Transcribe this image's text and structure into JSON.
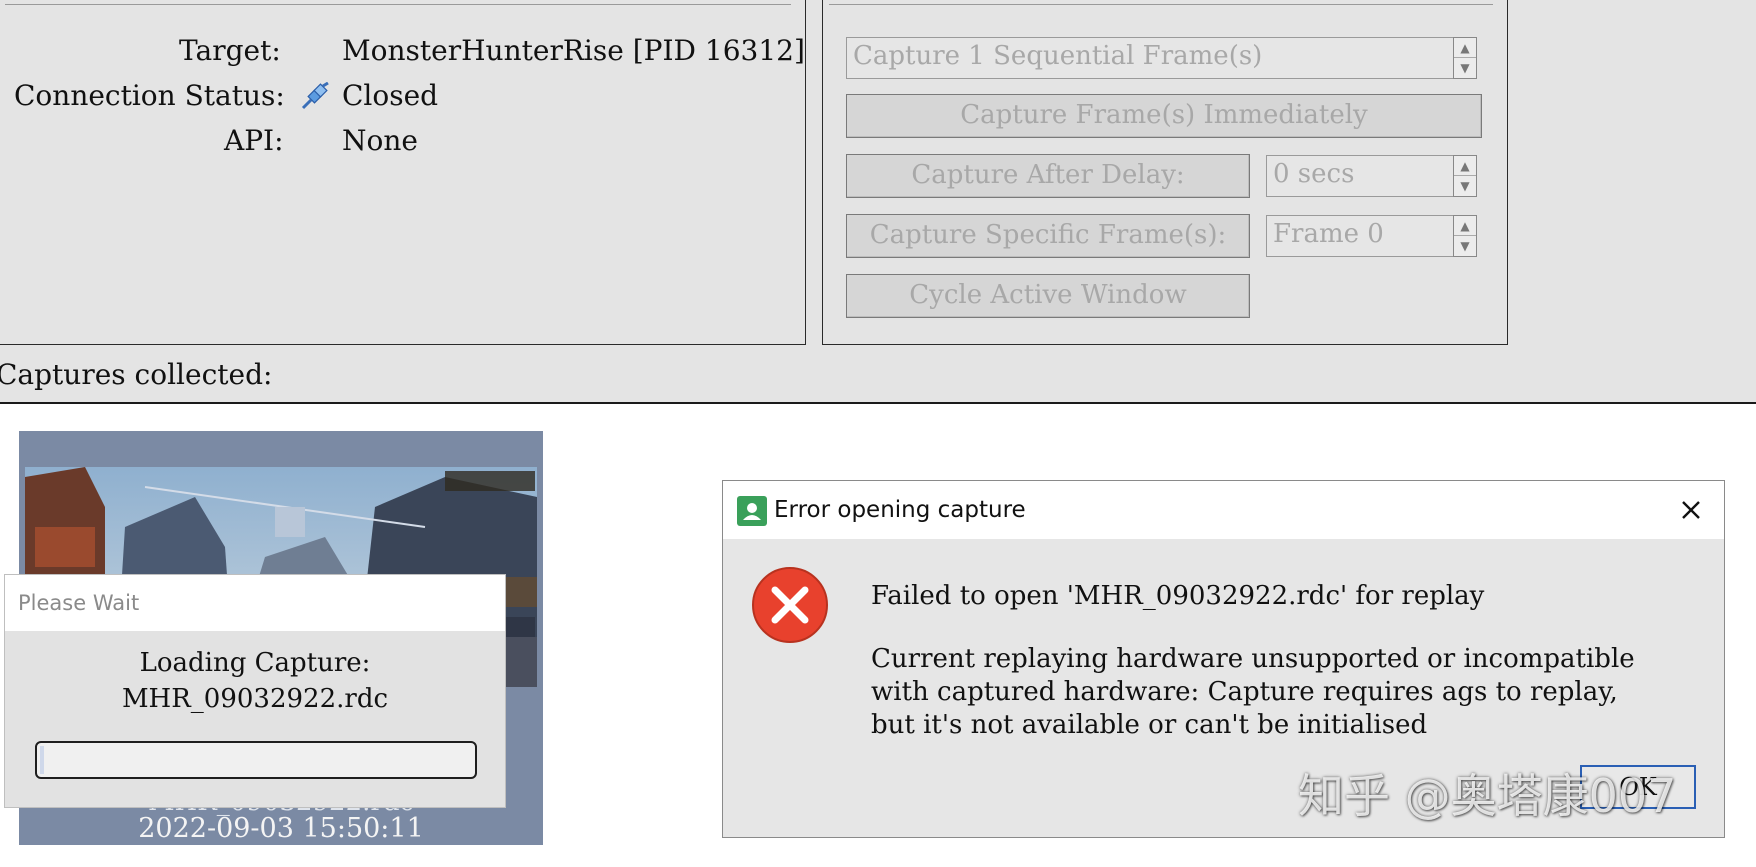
{
  "connection": {
    "target_label": "Target:",
    "target_value": "MonsterHunterRise [PID 16312]",
    "status_label": "Connection Status:",
    "status_icon": "network-plug-icon",
    "status_value": "Closed",
    "api_label": "API:",
    "api_value": "None"
  },
  "capture_controls": {
    "sequential_field": "Capture 1 Sequential Frame(s)",
    "immediately_button": "Capture Frame(s) Immediately",
    "after_delay_button": "Capture After Delay:",
    "delay_field": "0 secs",
    "specific_button": "Capture Specific Frame(s):",
    "frame_field": "Frame 0",
    "cycle_button": "Cycle Active Window"
  },
  "captures": {
    "label": "Captures collected:",
    "thumbnail": {
      "name": "MHR_09032922.rdc",
      "date": "2022-09-03 15:50:11"
    }
  },
  "wait_dialog": {
    "title": "Please Wait",
    "message_line1": "Loading Capture:",
    "message_line2": "MHR_09032922.rdc",
    "progress": 0.01
  },
  "error_dialog": {
    "title": "Error opening capture",
    "icon": "error-x-icon",
    "line1": "Failed to open 'MHR_09032922.rdc' for replay",
    "line2": "Current replaying hardware unsupported or incompatible",
    "line3": "with captured hardware: Capture requires ags to replay,",
    "line4": "but it's not available or can't be initialised",
    "ok_label": "OK"
  },
  "watermark": "知乎 @奥塔康007"
}
